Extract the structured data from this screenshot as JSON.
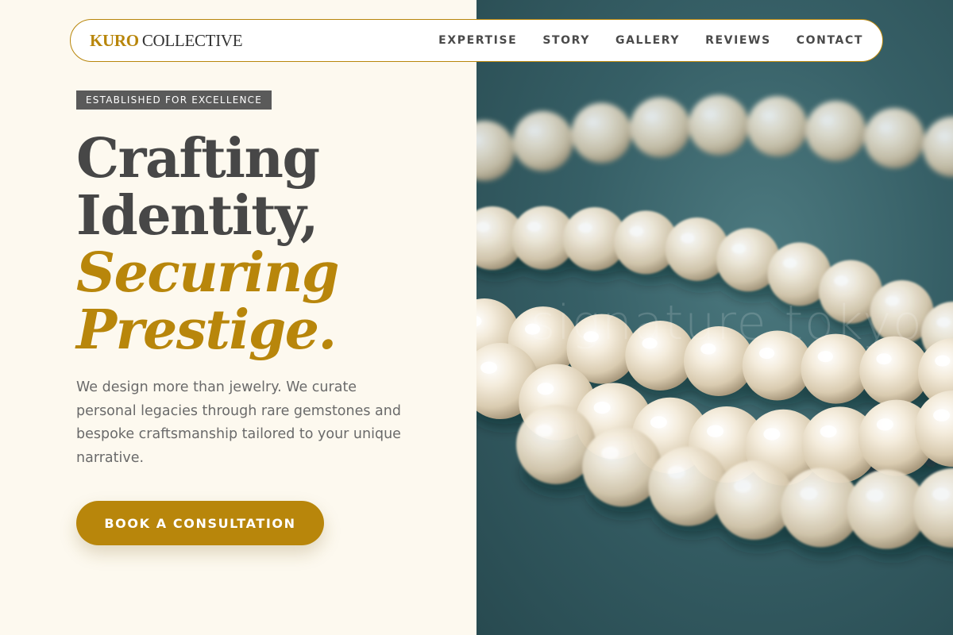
{
  "brand": {
    "accent": "KURO",
    "rest": "COLLECTIVE"
  },
  "nav": {
    "items": [
      {
        "label": "EXPERTISE"
      },
      {
        "label": "STORY"
      },
      {
        "label": "GALLERY"
      },
      {
        "label": "REVIEWS"
      },
      {
        "label": "CONTACT"
      }
    ]
  },
  "hero": {
    "badge": "ESTABLISHED FOR EXCELLENCE",
    "headline": {
      "line1": "Crafting",
      "line2": "Identity,",
      "line3": "Securing",
      "line4": "Prestige."
    },
    "intro": "We design more than jewelry. We curate personal legacies through rare gemstones and bespoke craftsmanship tailored to your unique narrative.",
    "cta_label": "BOOK A CONSULTATION",
    "image_watermark": "signature tokyo"
  },
  "colors": {
    "accent": "#b8860b",
    "background": "#fdf9ef",
    "text_dark": "#474747",
    "image_bg": "#365f66"
  }
}
